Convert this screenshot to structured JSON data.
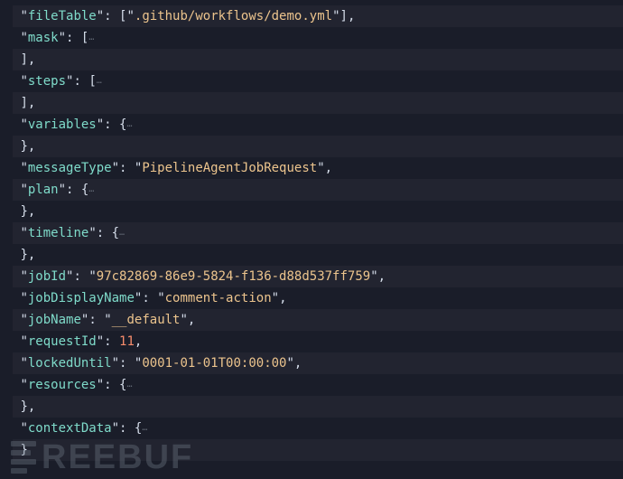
{
  "tokens": {
    "quote": "\"",
    "colon_sp": ": ",
    "comma": ",",
    "lbracket": "[",
    "rbracket": "]",
    "lbrace": "{",
    "rbrace": "}",
    "ellipsis": "…",
    "indent": " "
  },
  "keys": {
    "fileTable": "fileTable",
    "mask": "mask",
    "steps": "steps",
    "variables": "variables",
    "messageType": "messageType",
    "plan": "plan",
    "timeline": "timeline",
    "jobId": "jobId",
    "jobDisplayName": "jobDisplayName",
    "jobName": "jobName",
    "requestId": "requestId",
    "lockedUntil": "lockedUntil",
    "resources": "resources",
    "contextData": "contextData"
  },
  "values": {
    "fileTable0": ".github/workflows/demo.yml",
    "messageType": "PipelineAgentJobRequest",
    "jobId": "97c82869-86e9-5824-f136-d88d537ff759",
    "jobDisplayName": "comment-action",
    "jobName": "__default",
    "requestId": "11",
    "lockedUntil": "0001-01-01T00:00:00"
  },
  "watermark": {
    "text": "REEBUF"
  }
}
